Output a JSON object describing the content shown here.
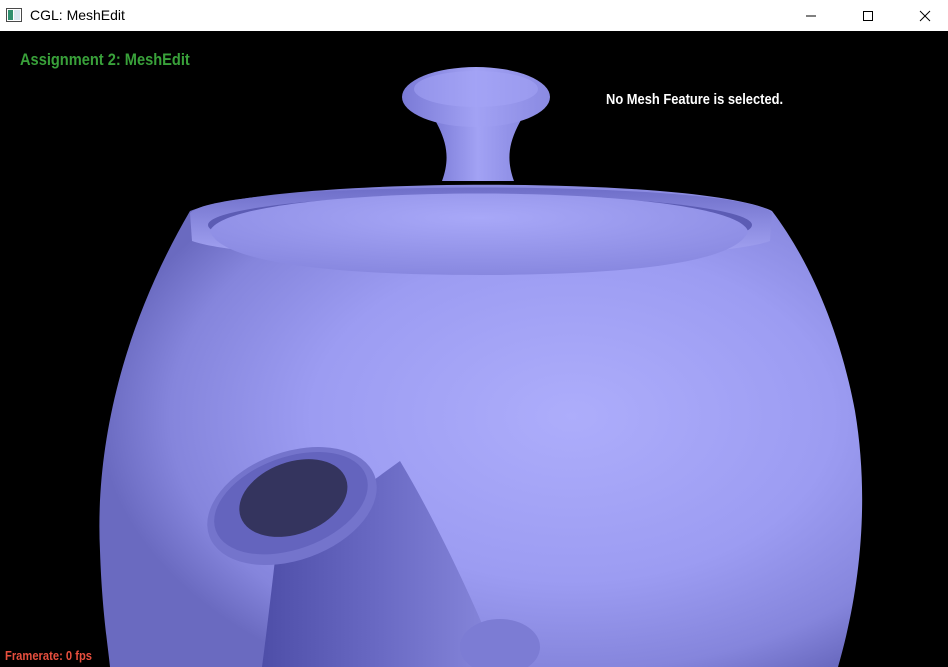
{
  "window": {
    "title": "CGL: MeshEdit",
    "icon": "app-window-icon",
    "controls": [
      "minimize-icon",
      "maximize-icon",
      "close-icon"
    ]
  },
  "hud": {
    "assignment_title": "Assignment 2: MeshEdit",
    "status": "No Mesh Feature is selected.",
    "framerate": "Framerate: 0 fps"
  },
  "colors": {
    "background": "#000000",
    "mesh": "#9c9cf4",
    "title_green": "#39a13a",
    "status_white": "#ffffff",
    "framerate_red": "#e84f3e"
  }
}
